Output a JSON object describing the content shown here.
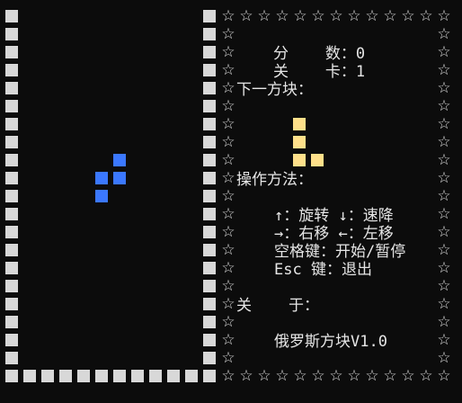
{
  "colors": {
    "background": "#0c0c0c",
    "wall": "#d8d8d8",
    "active_piece": "#3b78ff",
    "next_piece": "#ffe08a",
    "text": "#e6e6e6"
  },
  "board": {
    "cols": 10,
    "rows": 20,
    "active_piece": {
      "shape": "S (vertical)",
      "cells": [
        [
          6,
          8
        ],
        [
          5,
          9
        ],
        [
          6,
          9
        ],
        [
          5,
          10
        ]
      ]
    }
  },
  "star_char": "☆",
  "info": {
    "score_label": "分    数：",
    "score_value": "0",
    "level_label": "关    卡：",
    "level_value": "1",
    "next_label": "下一方块：",
    "next_piece": {
      "shape": "L",
      "cells": [
        [
          0,
          0
        ],
        [
          0,
          1
        ],
        [
          0,
          2
        ],
        [
          1,
          2
        ]
      ]
    },
    "controls_title": "操作方法：",
    "controls": [
      "↑：旋转 ↓：速降",
      "→：右移 ←：左移",
      "空格键：开始/暂停",
      "Esc 键：退出"
    ],
    "about_label": "关    于：",
    "about_text": "俄罗斯方块V1.0"
  }
}
